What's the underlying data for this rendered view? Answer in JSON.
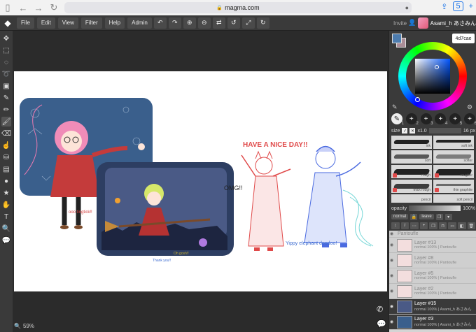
{
  "browser": {
    "url": "magma.com",
    "tab_count": "5"
  },
  "menu": {
    "items": [
      "File",
      "Edit",
      "View",
      "Filter",
      "Help",
      "Admin"
    ],
    "invite_label": "Invite",
    "user_name": "Asami_h あさみん"
  },
  "color": {
    "hex": "4d7cae",
    "foreground": "#4d7cae",
    "background": "#aa8d98"
  },
  "brush": {
    "slots": [
      "1",
      "2",
      "3",
      "4",
      "5",
      "6"
    ],
    "size_label": "size",
    "multiplier": "x1.0",
    "size_value": "16 px",
    "cards": [
      {
        "label": "ink"
      },
      {
        "label": "soft ink"
      },
      {
        "label": "soft"
      },
      {
        "label": "softer"
      },
      {
        "label": "rough"
      },
      {
        "label": "rougher"
      },
      {
        "label": "thick rough"
      },
      {
        "label": "thin graphite"
      },
      {
        "label": "pencil"
      },
      {
        "label": "soft pencil"
      }
    ],
    "opacity_label": "opacity",
    "opacity_value": "100%"
  },
  "layer_controls": {
    "blend_mode": "normal",
    "leave_label": "leave"
  },
  "layers": [
    {
      "name": "Pantoufle",
      "sub": "",
      "dark": false
    },
    {
      "name": "Layer #13",
      "sub": "normal 100% | Pantoufle",
      "dark": false
    },
    {
      "name": "Layer #8",
      "sub": "normal 100% | Pantoufle",
      "dark": false
    },
    {
      "name": "Layer #5",
      "sub": "normal 100% | Pantoufle",
      "dark": false
    },
    {
      "name": "Layer #2",
      "sub": "normal 100% | Pantoufle",
      "dark": false
    },
    {
      "name": "Layer #15",
      "sub": "normal 100% | Asami_h あさみん",
      "dark": true
    },
    {
      "name": "Layer #3",
      "sub": "normal 100% | Asami_h あさみん",
      "dark": true
    }
  ],
  "canvas": {
    "zoom": "59%",
    "art_texts": {
      "have_nice_day": "HAVE A NICE DAY!!",
      "omg": "OMG!!",
      "yippy": "Yippy elephant doodoo!",
      "goodnight": "goodnight",
      "sig": "@Asami_h"
    }
  }
}
